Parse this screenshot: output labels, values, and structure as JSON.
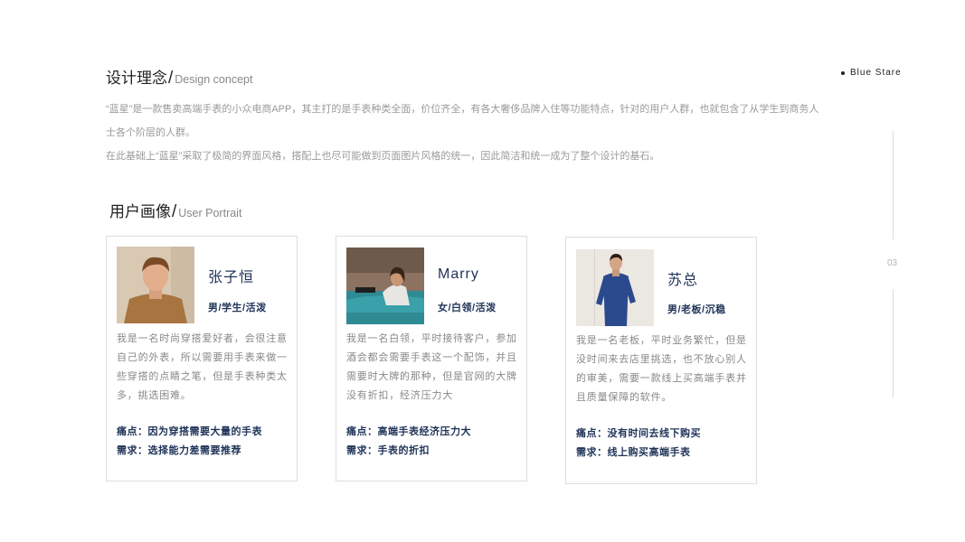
{
  "brand": {
    "name": "Blue Stare"
  },
  "design_concept": {
    "title_zh": "设计理念",
    "title_en": "Design concept",
    "paragraph_1": "“蓝星”是一款售卖高端手表的小众电商APP，其主打的是手表种类全面，价位齐全，有各大奢侈品牌入住等功能特点，针对的用户人群，也就包含了从学生到商务人士各个阶层的人群。",
    "paragraph_2": "在此基础上“蓝星”采取了极简的界面风格，搭配上也尽可能做到页面图片风格的统一，因此简洁和统一成为了整个设计的基石。"
  },
  "user_portrait": {
    "title_zh": "用户画像",
    "title_en": "User Portrait",
    "personas": [
      {
        "name": "张子恒",
        "tags": "男/学生/活泼",
        "description": "我是一名时尚穿搭爱好者，会很注意自己的外表，所以需要用手表来做一些穿搭的点睛之笔，但是手表种类太多，挑选困难。",
        "pain_point": "痛点：因为穿搭需要大量的手表",
        "need": "需求：选择能力差需要推荐"
      },
      {
        "name": "Marry",
        "tags": "女/白领/活泼",
        "description": "我是一名白领，平时接待客户，参加酒会都会需要手表这一个配饰，并且需要时大牌的那种，但是官网的大牌没有折扣，经济压力大",
        "pain_point": "痛点：高端手表经济压力大",
        "need": "需求：手表的折扣"
      },
      {
        "name": "苏总",
        "tags": "男/老板/沉稳",
        "description": "我是一名老板，平时业务繁忙，但是没时间来去店里挑选，也不放心别人的审美，需要一款线上买高端手表并且质量保障的软件。",
        "pain_point": "痛点：没有时间去线下购买",
        "need": "需求：线上购买高端手表"
      }
    ]
  },
  "page_number": "03",
  "colors": {
    "accent": "#1f3358",
    "muted": "#9a9a9a",
    "border": "#dedede"
  },
  "icons": {
    "brand_bullet": "bullet-dot"
  }
}
